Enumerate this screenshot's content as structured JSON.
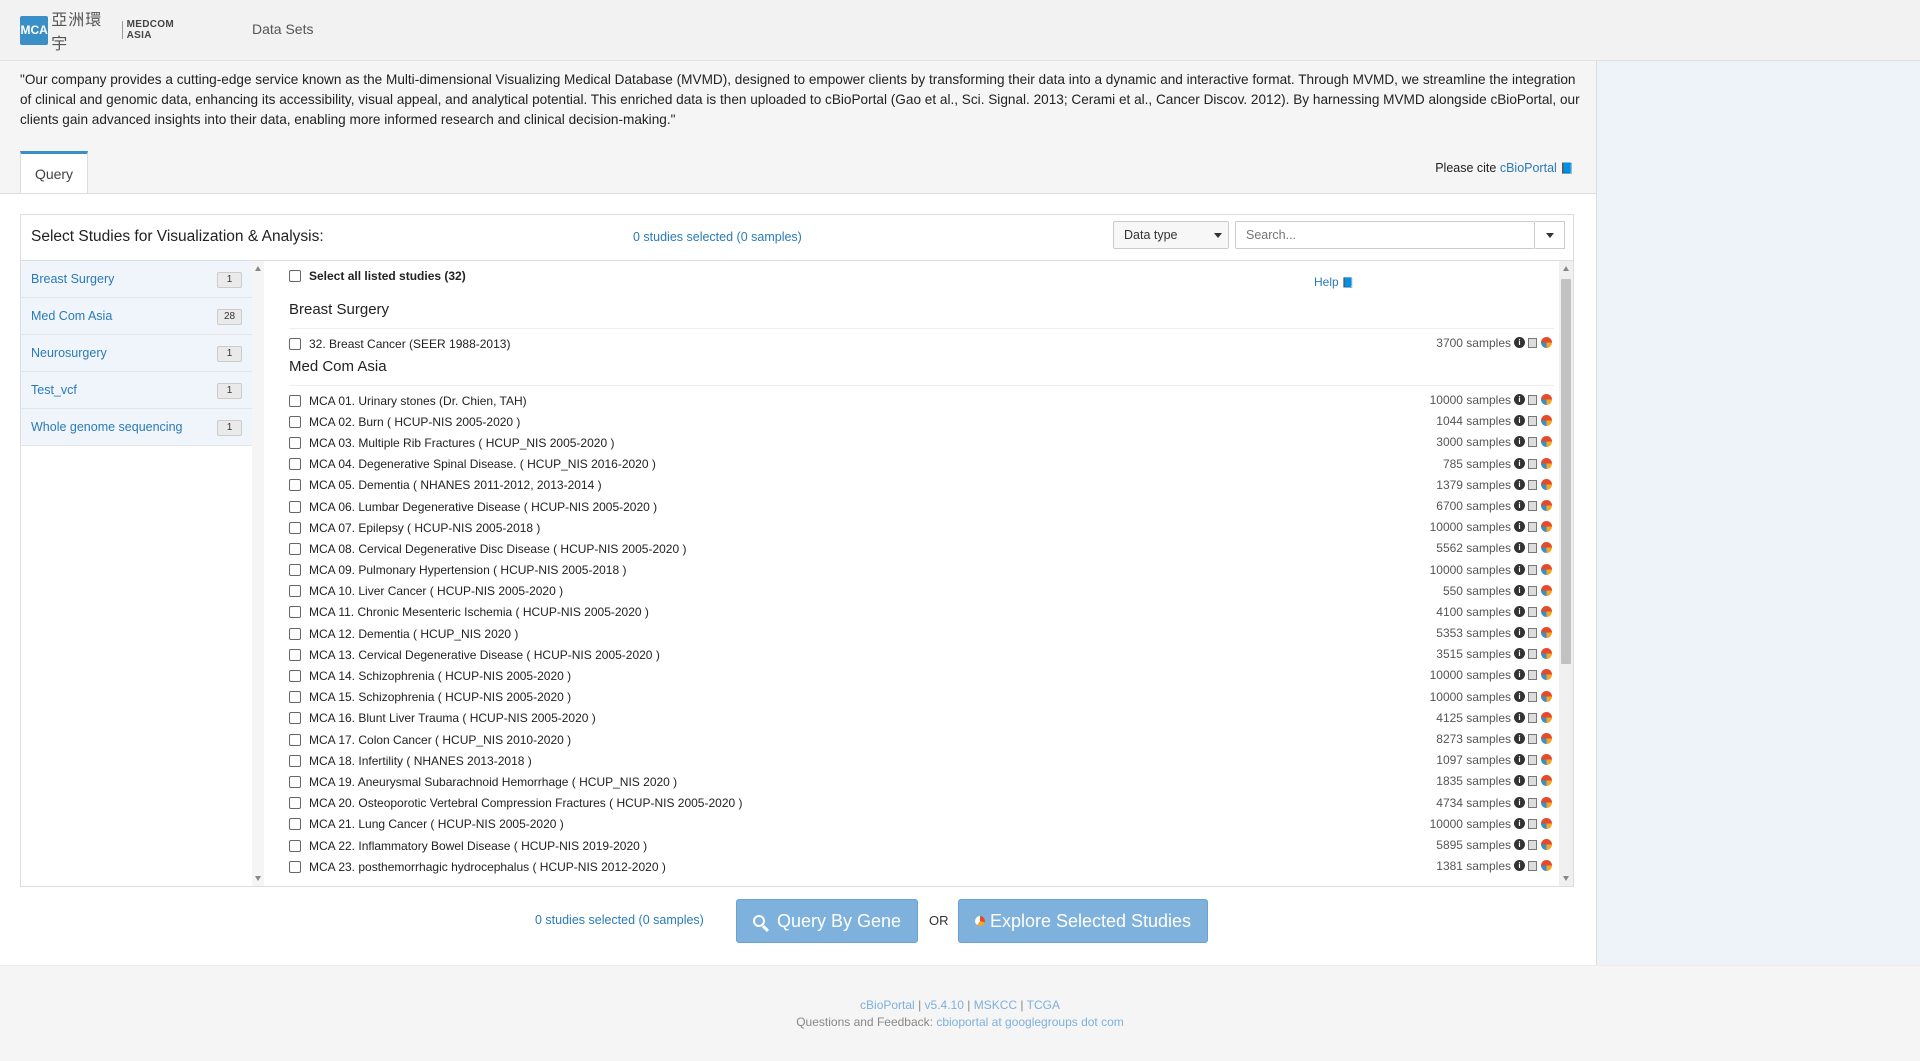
{
  "header": {
    "logo_mark": "MCA",
    "logo_cn": "亞洲環宇",
    "logo_en": "MEDCOM ASIA",
    "nav_datasets": "Data Sets"
  },
  "intro_text": "\"Our company provides a cutting-edge service known as the Multi-dimensional Visualizing Medical Database (MVMD), designed to empower clients by transforming their data into a dynamic and interactive format. Through MVMD, we streamline the integration of clinical and genomic data, enhancing its accessibility, visual appeal, and analytical potential. This enriched data is then uploaded to cBioPortal (Gao et al., Sci. Signal. 2013; Cerami et al., Cancer Discov. 2012). By harnessing MVMD alongside cBioPortal, our clients gain advanced insights into their data, enabling more informed research and clinical decision-making.\"",
  "tabs": {
    "query": "Query"
  },
  "cite": {
    "prefix": "Please cite ",
    "link": "cBioPortal",
    "book": "📘"
  },
  "panel": {
    "title": "Select Studies for Visualization & Analysis:",
    "selected": "0 studies selected (0 samples)",
    "data_type": "Data type",
    "search_placeholder": "Search...",
    "select_all": "Select all listed studies (32)",
    "help": "Help"
  },
  "sidebar": [
    {
      "label": "Breast Surgery",
      "count": "1"
    },
    {
      "label": "Med Com Asia",
      "count": "28"
    },
    {
      "label": "Neurosurgery",
      "count": "1"
    },
    {
      "label": "Test_vcf",
      "count": "1"
    },
    {
      "label": "Whole genome sequencing",
      "count": "1"
    }
  ],
  "groups": [
    {
      "title": "Breast Surgery",
      "studies": [
        {
          "name": "32. Breast Cancer (SEER 1988-2013)",
          "samples": "3700 samples"
        }
      ]
    },
    {
      "title": "Med Com Asia",
      "studies": [
        {
          "name": "MCA 01. Urinary stones (Dr. Chien, TAH)",
          "samples": "10000 samples"
        },
        {
          "name": "MCA 02. Burn ( HCUP-NIS 2005-2020 )",
          "samples": "1044 samples"
        },
        {
          "name": "MCA 03. Multiple Rib Fractures ( HCUP_NIS 2005-2020 )",
          "samples": "3000 samples"
        },
        {
          "name": "MCA 04. Degenerative Spinal Disease. ( HCUP_NIS 2016-2020 )",
          "samples": "785 samples"
        },
        {
          "name": "MCA 05. Dementia ( NHANES 2011-2012, 2013-2014 )",
          "samples": "1379 samples"
        },
        {
          "name": "MCA 06. Lumbar Degenerative Disease ( HCUP-NIS 2005-2020 )",
          "samples": "6700 samples"
        },
        {
          "name": "MCA 07. Epilepsy ( HCUP-NIS 2005-2018 )",
          "samples": "10000 samples"
        },
        {
          "name": "MCA 08. Cervical Degenerative Disc Disease ( HCUP-NIS 2005-2020 )",
          "samples": "5562 samples"
        },
        {
          "name": "MCA 09. Pulmonary Hypertension ( HCUP-NIS 2005-2018 )",
          "samples": "10000 samples"
        },
        {
          "name": "MCA 10. Liver Cancer ( HCUP-NIS 2005-2020 )",
          "samples": "550 samples"
        },
        {
          "name": "MCA 11. Chronic Mesenteric Ischemia ( HCUP-NIS 2005-2020 )",
          "samples": "4100 samples"
        },
        {
          "name": "MCA 12. Dementia ( HCUP_NIS 2020 )",
          "samples": "5353 samples"
        },
        {
          "name": "MCA 13. Cervical Degenerative Disease ( HCUP-NIS 2005-2020 )",
          "samples": "3515 samples"
        },
        {
          "name": "MCA 14. Schizophrenia ( HCUP-NIS 2005-2020 )",
          "samples": "10000 samples"
        },
        {
          "name": "MCA 15. Schizophrenia ( HCUP-NIS 2005-2020 )",
          "samples": "10000 samples"
        },
        {
          "name": "MCA 16. Blunt Liver Trauma ( HCUP-NIS 2005-2020 )",
          "samples": "4125 samples"
        },
        {
          "name": "MCA 17. Colon Cancer ( HCUP_NIS 2010-2020 )",
          "samples": "8273 samples"
        },
        {
          "name": "MCA 18. Infertility ( NHANES 2013-2018 )",
          "samples": "1097 samples"
        },
        {
          "name": "MCA 19. Aneurysmal Subarachnoid Hemorrhage ( HCUP_NIS 2020 )",
          "samples": "1835 samples"
        },
        {
          "name": "MCA 20. Osteoporotic Vertebral Compression Fractures ( HCUP-NIS 2005-2020 )",
          "samples": "4734 samples"
        },
        {
          "name": "MCA 21. Lung Cancer ( HCUP-NIS 2005-2020 )",
          "samples": "10000 samples"
        },
        {
          "name": "MCA 22. Inflammatory Bowel Disease ( HCUP-NIS 2019-2020 )",
          "samples": "5895 samples"
        },
        {
          "name": "MCA 23. posthemorrhagic hydrocephalus ( HCUP-NIS 2012-2020 )",
          "samples": "1381 samples"
        }
      ]
    }
  ],
  "actions": {
    "bottom_selected": "0 studies selected (0 samples)",
    "query_by_gene": "Query By Gene",
    "or": "OR",
    "explore": "Explore Selected Studies"
  },
  "footer": {
    "cbioportal": "cBioPortal",
    "version": "v5.4.10",
    "mskcc": "MSKCC",
    "tcga": "TCGA",
    "sep": " | ",
    "feedback_prefix": "Questions and Feedback: ",
    "feedback_link": "cbioportal at googlegroups dot com"
  },
  "colors": {
    "accent": "#3a8fc6",
    "link": "#2a7ab8",
    "button": "#7eb1dc"
  },
  "icons": [
    "info-icon",
    "book-icon",
    "pie-chart-icon",
    "search-icon",
    "caret-down-icon"
  ]
}
